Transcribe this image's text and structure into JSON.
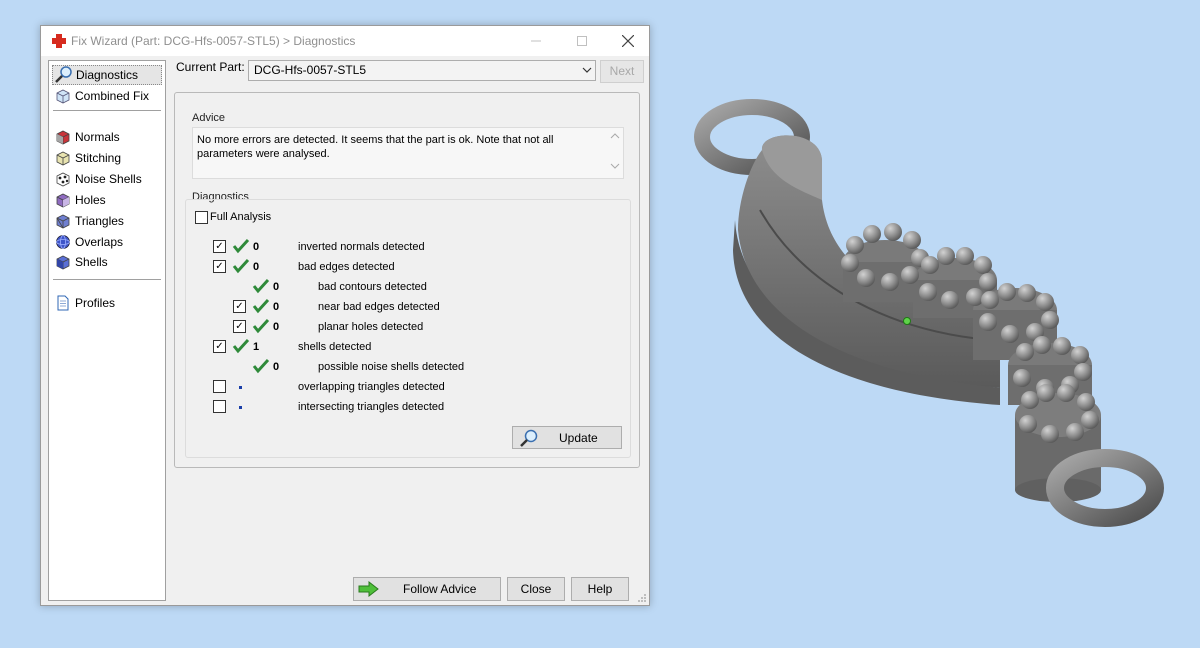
{
  "window": {
    "title": "Fix Wizard (Part: DCG-Hfs-0057-STL5) > Diagnostics"
  },
  "sidebar": {
    "items": [
      {
        "label": "Diagnostics",
        "icon": "magnifier-icon"
      },
      {
        "label": "Combined Fix",
        "icon": "cube-icon"
      },
      {
        "label": "Normals",
        "icon": "normals-cube-icon"
      },
      {
        "label": "Stitching",
        "icon": "stitching-cube-icon"
      },
      {
        "label": "Noise Shells",
        "icon": "noise-shells-icon"
      },
      {
        "label": "Holes",
        "icon": "holes-cube-icon"
      },
      {
        "label": "Triangles",
        "icon": "triangles-cube-icon"
      },
      {
        "label": "Overlaps",
        "icon": "overlaps-sphere-icon"
      },
      {
        "label": "Shells",
        "icon": "shells-cube-icon"
      },
      {
        "label": "Profiles",
        "icon": "document-icon"
      }
    ]
  },
  "current_part": {
    "label": "Current Part:",
    "value": "DCG-Hfs-0057-STL5",
    "next_label": "Next"
  },
  "advice": {
    "title": "Advice",
    "text": "No more errors are detected. It seems that the part is ok. Note that not all parameters were analysed."
  },
  "diagnostics": {
    "title": "Diagnostics",
    "full_analysis_label": "Full Analysis",
    "full_analysis_checked": false,
    "rows": [
      {
        "label": "inverted normals detected",
        "count": "0",
        "checked": true,
        "status": "ok",
        "has_checkbox": true
      },
      {
        "label": "bad edges detected",
        "count": "0",
        "checked": true,
        "status": "ok",
        "has_checkbox": true
      },
      {
        "label": "bad contours detected",
        "count": "0",
        "checked": false,
        "status": "ok",
        "has_checkbox": false
      },
      {
        "label": "near bad edges detected",
        "count": "0",
        "checked": true,
        "status": "ok",
        "has_checkbox": true
      },
      {
        "label": "planar holes detected",
        "count": "0",
        "checked": true,
        "status": "ok",
        "has_checkbox": true
      },
      {
        "label": "shells detected",
        "count": "1",
        "checked": true,
        "status": "ok",
        "has_checkbox": true
      },
      {
        "label": "possible noise shells detected",
        "count": "0",
        "checked": false,
        "status": "ok",
        "has_checkbox": false
      },
      {
        "label": "overlapping triangles detected",
        "count": "",
        "checked": false,
        "status": "not-analysed",
        "has_checkbox": true
      },
      {
        "label": "intersecting triangles detected",
        "count": "",
        "checked": false,
        "status": "not-analysed",
        "has_checkbox": true
      }
    ],
    "update_label": "Update"
  },
  "buttons": {
    "follow_advice": "Follow Advice",
    "close": "Close",
    "help": "Help"
  },
  "colors": {
    "viewport_bg": "#bdd9f5",
    "check_green": "#2f8a3a",
    "model_gray": "#7a7a7a"
  }
}
